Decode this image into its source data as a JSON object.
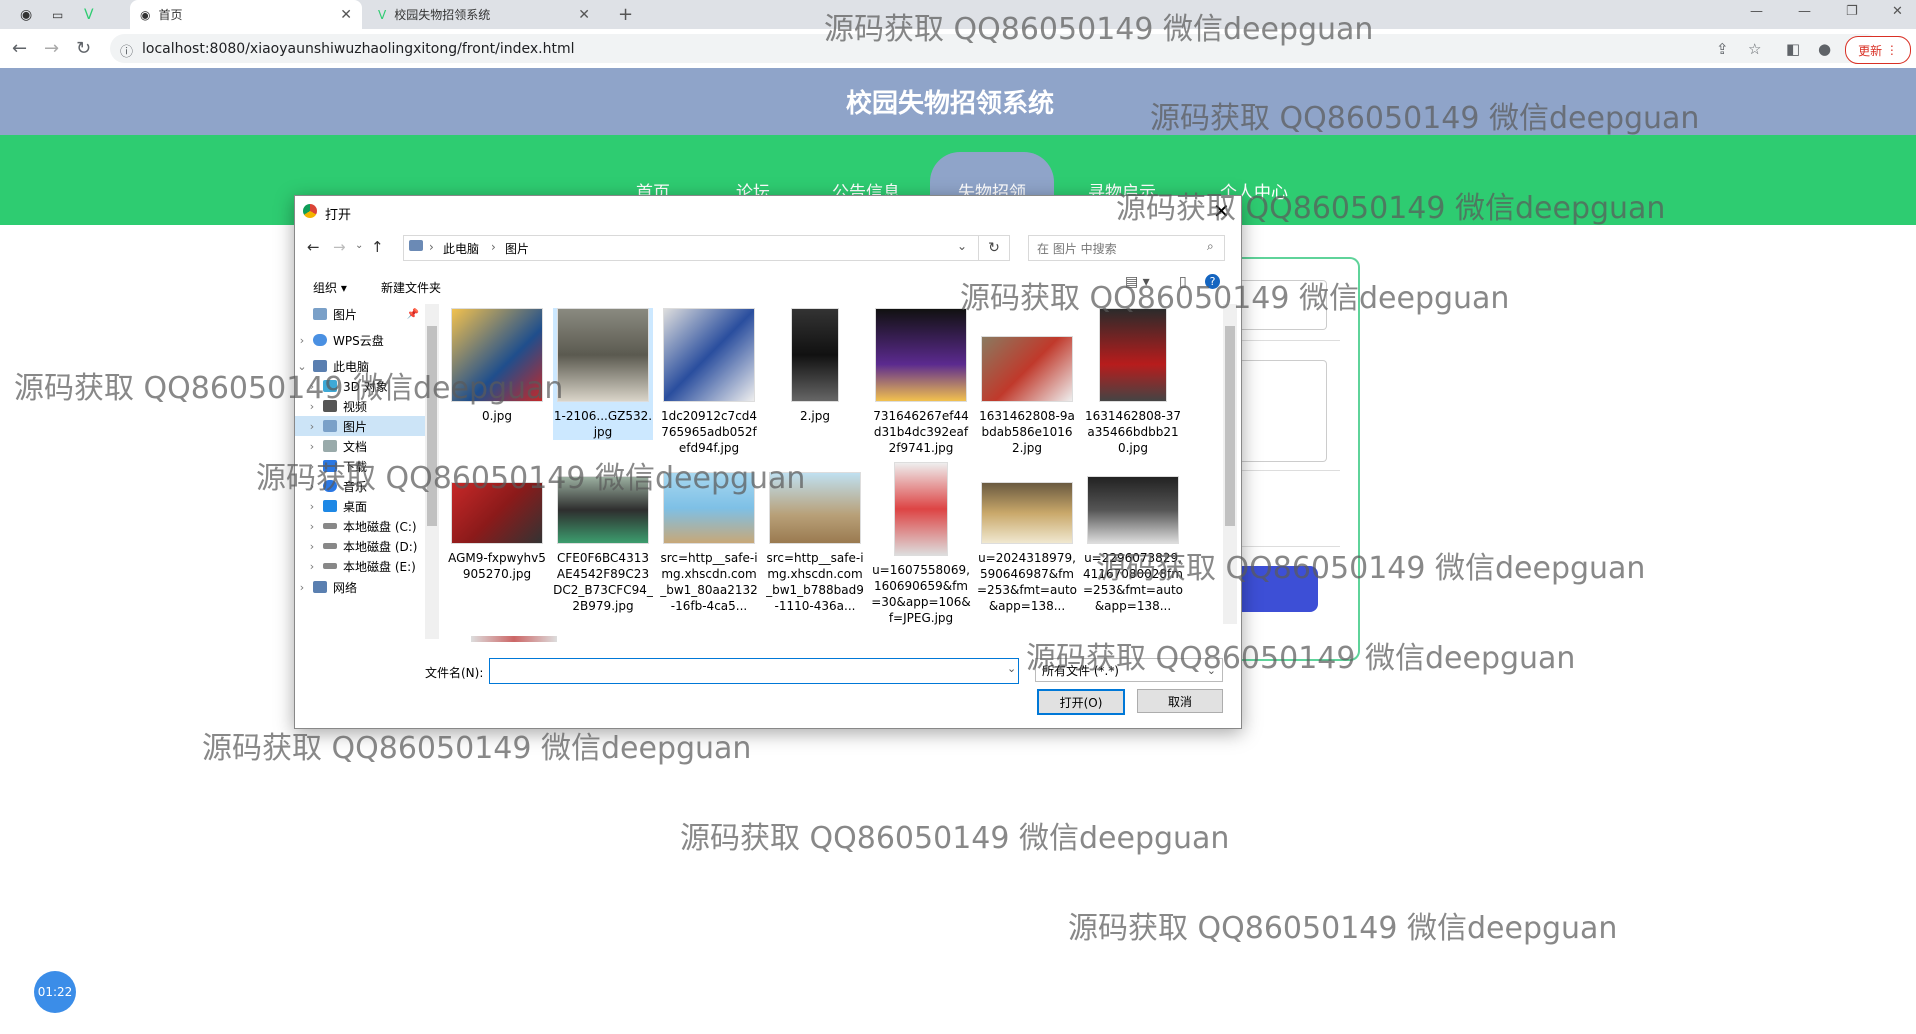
{
  "browser": {
    "tabs": [
      {
        "label": "首页"
      },
      {
        "label": "校园失物招领系统"
      }
    ],
    "url": "localhost:8080/xiaoyaunshiwuzhaolingxitong/front/index.html",
    "update_label": "更新"
  },
  "site": {
    "title": "校园失物招领系统",
    "nav": [
      "首页",
      "论坛",
      "公告信息",
      "失物招领",
      "寻物启示",
      "个人中心"
    ],
    "active_nav": "失物招领"
  },
  "dialog": {
    "title": "打开",
    "breadcrumb": [
      "此电脑",
      "图片"
    ],
    "search_placeholder": "在 图片 中搜索",
    "toolbar": {
      "organize": "组织 ▾",
      "new_folder": "新建文件夹"
    },
    "nav_items": [
      {
        "label": "图片",
        "pinned": true
      },
      {
        "label": "WPS云盘"
      },
      {
        "label": "此电脑"
      },
      {
        "label": "3D 对象"
      },
      {
        "label": "视频"
      },
      {
        "label": "图片",
        "selected": true
      },
      {
        "label": "文档"
      },
      {
        "label": "下载"
      },
      {
        "label": "音乐"
      },
      {
        "label": "桌面"
      },
      {
        "label": "本地磁盘 (C:)"
      },
      {
        "label": "本地磁盘 (D:)"
      },
      {
        "label": "本地磁盘 (E:)"
      },
      {
        "label": "网络"
      }
    ],
    "files": [
      {
        "name": "0.jpg"
      },
      {
        "name": "1-2106...GZ532.jpg"
      },
      {
        "name": "1dc20912c7cd4765965adb052fefd94f.jpg"
      },
      {
        "name": "2.jpg"
      },
      {
        "name": "731646267ef44d31b4dc392eaf2f9741.jpg"
      },
      {
        "name": "1631462808-9abdab586e10162.jpg"
      },
      {
        "name": "1631462808-37a35466bdbb210.jpg"
      },
      {
        "name": "AGM9-fxpwyhv5905270.jpg"
      },
      {
        "name": "CFE0F6BC4313AE4542F89C23DC2_B73CFC94_2B979.jpg"
      },
      {
        "name": "src=http__safe-img.xhscdn.com_bw1_80aa2132-16fb-4ca5..."
      },
      {
        "name": "src=http__safe-img.xhscdn.com_bw1_b788bad9-1110-436a..."
      },
      {
        "name": "u=1607558069,160690659&fm=30&app=106&f=JPEG.jpg"
      },
      {
        "name": "u=2024318979,590646987&fm=253&fmt=auto&app=138..."
      },
      {
        "name": "u=2296073829,41167080028fm=253&fmt=auto&app=138..."
      }
    ],
    "filename_label": "文件名(N):",
    "filename_value": "",
    "filetype": "所有文件 (*.*)",
    "open_label": "打开(O)",
    "cancel_label": "取消"
  },
  "watermark": "源码获取 QQ86050149 微信deepguan",
  "timer": "01:22",
  "colors": {
    "header": "#8fa4c9",
    "nav": "#2ecc71",
    "accent": "#3d4fd6"
  }
}
